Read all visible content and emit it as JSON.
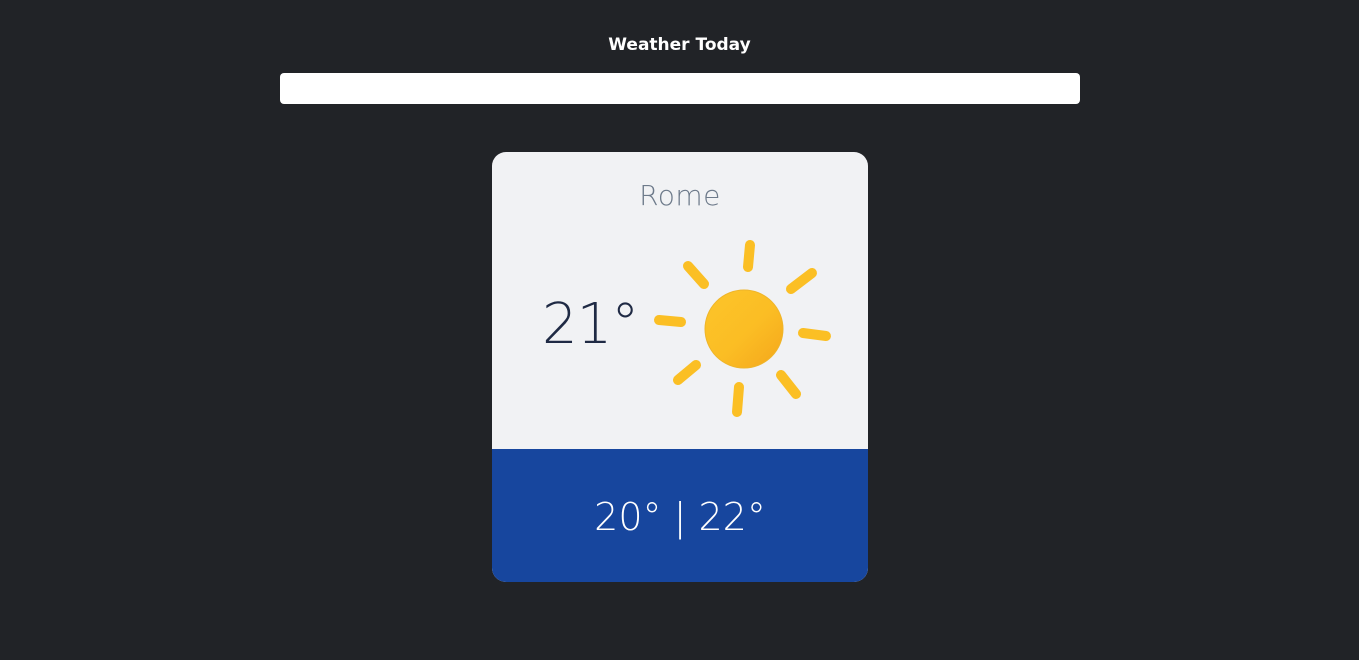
{
  "header": {
    "title": "Weather Today"
  },
  "search": {
    "value": "",
    "placeholder": ""
  },
  "weather_card": {
    "city": "Rome",
    "temperature": "21°",
    "icon": "sun-icon",
    "range_text": "20° | 22°",
    "colors": {
      "card_background": "#f1f2f4",
      "range_background": "#17469e",
      "sun": "#fbbf24"
    }
  }
}
